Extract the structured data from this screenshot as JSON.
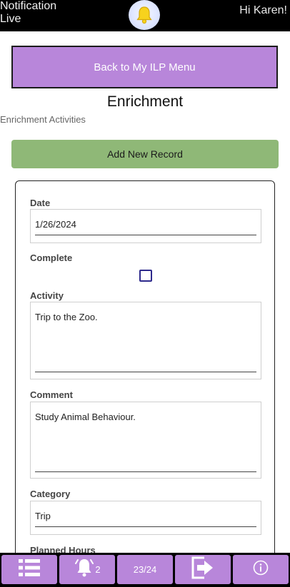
{
  "header": {
    "notification_label": "Notification Live",
    "notification_line1": "Notification",
    "notification_line2": "Live",
    "bell_icon": "bell-icon",
    "greeting": "Hi Karen!"
  },
  "back_button": {
    "label": "Back to My ILP Menu"
  },
  "page": {
    "title": "Enrichment",
    "subtitle": "Enrichment Activities"
  },
  "add_button": {
    "label": "Add New Record"
  },
  "form": {
    "date": {
      "label": "Date",
      "value": "1/26/2024"
    },
    "complete": {
      "label": "Complete",
      "checked": false
    },
    "activity": {
      "label": "Activity",
      "value": "Trip to the Zoo."
    },
    "comment": {
      "label": "Comment",
      "value": "Study Animal Behaviour."
    },
    "category": {
      "label": "Category",
      "value": "Trip"
    },
    "planned_hours": {
      "label": "Planned Hours"
    }
  },
  "bottom_bar": {
    "menu_icon": "list-menu-icon",
    "alerts_icon": "bell-icon",
    "alerts_count": "2",
    "record_position": "23/24",
    "logout_icon": "arrow-right-icon",
    "info_icon": "info-icon"
  },
  "colors": {
    "purple": "#b886da",
    "green": "#8fb877",
    "black": "#000000",
    "checkbox_border": "#2e2a8c"
  }
}
